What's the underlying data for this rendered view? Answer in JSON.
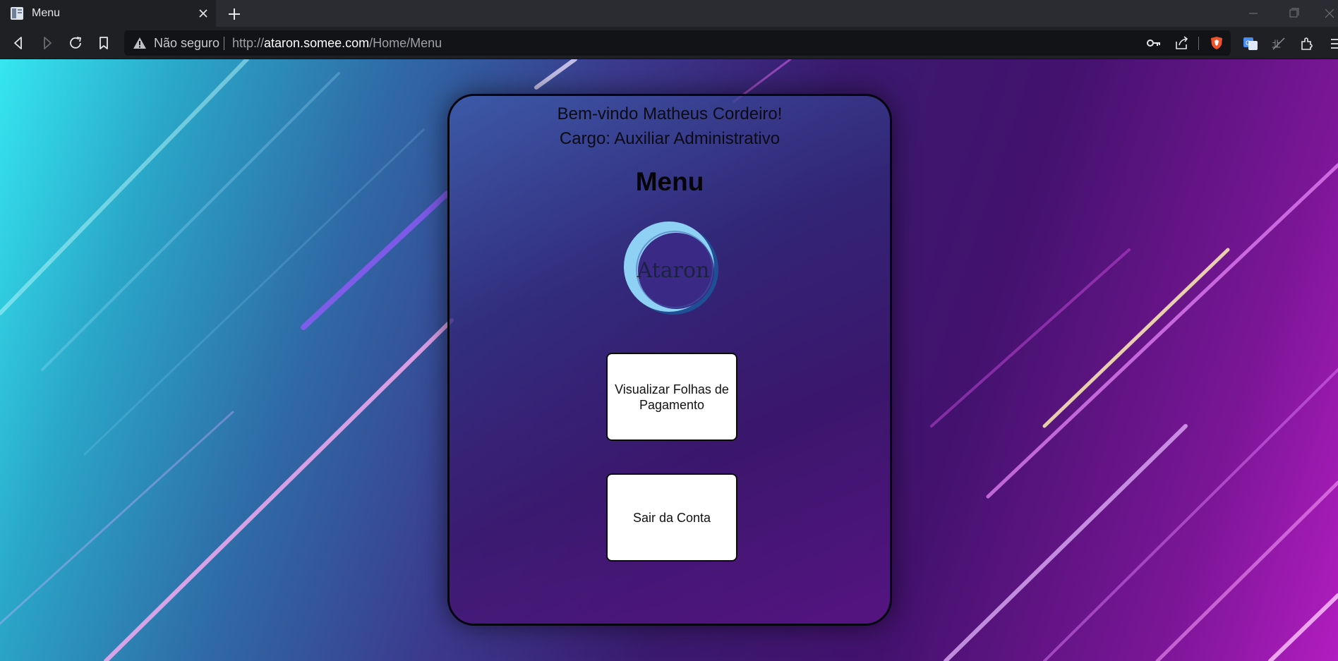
{
  "browser": {
    "tab": {
      "title": "Menu"
    },
    "address_bar": {
      "security_label": "Não seguro",
      "url_scheme": "http://",
      "url_host": "ataron.somee.com",
      "url_path": "/Home/Menu"
    },
    "icons": [
      "tab-favicon-icon",
      "close-icon",
      "plus-icon",
      "back-icon",
      "forward-icon",
      "reload-icon",
      "bookmark-icon",
      "warning-icon",
      "key-icon",
      "share-icon",
      "brave-shield-icon",
      "translate-icon",
      "translate-off-icon",
      "extensions-icon",
      "menu-icon"
    ]
  },
  "page": {
    "welcome_text": "Bem-vindo Matheus Cordeiro!",
    "role_text": "Cargo: Auxiliar Administrativo",
    "menu_title": "Menu",
    "logo_text": "Ataron",
    "buttons": {
      "view_payroll": "Visualizar Folhas de Pagamento",
      "logout": "Sair da Conta"
    }
  },
  "colors": {
    "card_border": "#050510",
    "button_bg": "#ffffff",
    "logo_ring_light": "#8fd0f5",
    "logo_ring_dark": "#1e4f95"
  }
}
